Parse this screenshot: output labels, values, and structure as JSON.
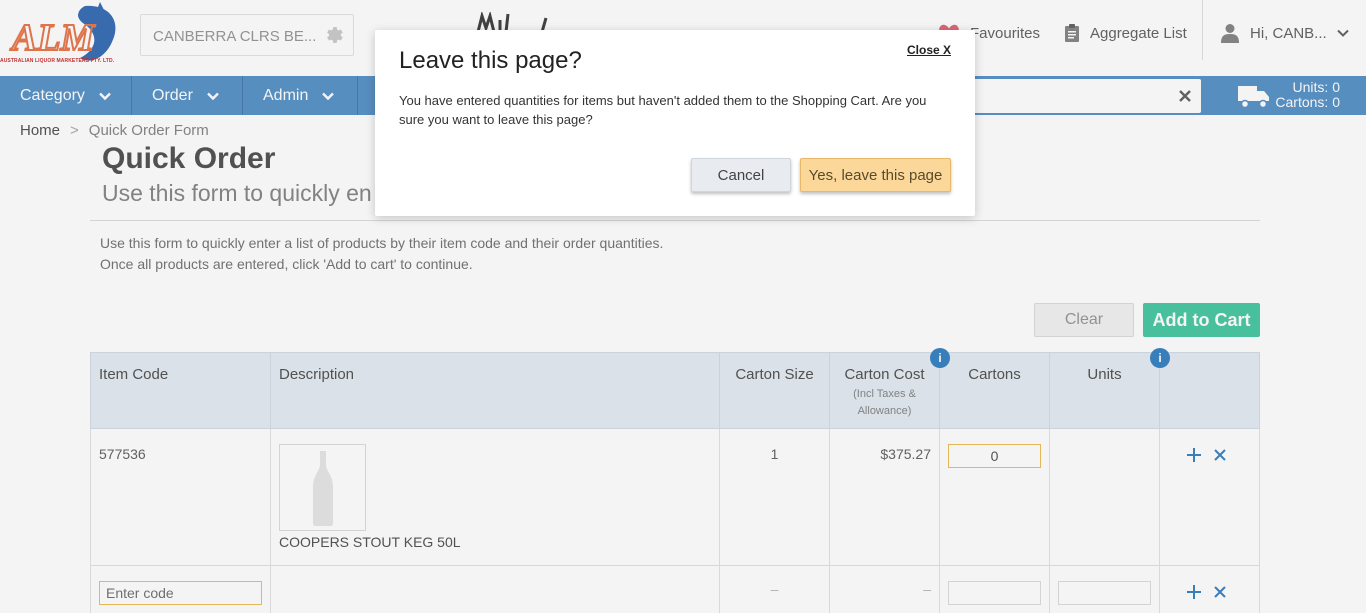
{
  "header": {
    "logo_text": "AUSTRALIAN LIQUOR MARKETERS PTY. LTD.",
    "store_name": "CANBERRA CLRS BE...",
    "favourites_label": "Favourites",
    "aggregate_label": "Aggregate List",
    "user_label": "Hi, CANB..."
  },
  "nav": {
    "items": [
      {
        "label": "Category"
      },
      {
        "label": "Order"
      },
      {
        "label": "Admin"
      }
    ],
    "cart_units": "Units: 0",
    "cart_cartons": "Cartons: 0"
  },
  "breadcrumb": {
    "home": "Home",
    "separator": ">",
    "current": "Quick Order Form"
  },
  "page": {
    "title": "Quick Order",
    "subtitle": "Use this form to quickly en",
    "intro_line1": "Use this form to quickly enter a list of products by their item code and their order quantities.",
    "intro_line2": "Once all products are entered, click 'Add to cart' to continue.",
    "clear_label": "Clear",
    "add_to_cart_label": "Add to Cart"
  },
  "table": {
    "headers": {
      "item_code": "Item Code",
      "description": "Description",
      "carton_size": "Carton Size",
      "carton_cost": "Carton Cost",
      "carton_cost_sub1": "(Incl Taxes &",
      "carton_cost_sub2": "Allowance)",
      "cartons": "Cartons",
      "units": "Units",
      "info_glyph": "i"
    },
    "rows": [
      {
        "item_code": "577536",
        "description": "COOPERS STOUT KEG 50L",
        "carton_size": "1",
        "carton_cost": "$375.27",
        "cartons": "0"
      }
    ],
    "new_row": {
      "code_placeholder": "Enter code",
      "carton_size": "–",
      "carton_cost": "–"
    }
  },
  "modal": {
    "title": "Leave this page?",
    "close_label": "Close X",
    "body": "You have entered quantities for items but haven't added them to the Shopping Cart. Are you sure you want to leave this page?",
    "cancel_label": "Cancel",
    "confirm_label": "Yes, leave this page"
  },
  "colors": {
    "nav_bg": "#5b95c9",
    "add_to_cart": "#4cc9a5",
    "confirm_btn": "#fbd89a",
    "info_dot": "#3b84c4"
  },
  "icons": [
    "gear-icon",
    "heart-icon",
    "clipboard-icon",
    "user-icon",
    "chevron-down-icon",
    "close-icon",
    "truck-icon",
    "info-icon",
    "plus-icon",
    "remove-icon",
    "bottle-icon"
  ]
}
